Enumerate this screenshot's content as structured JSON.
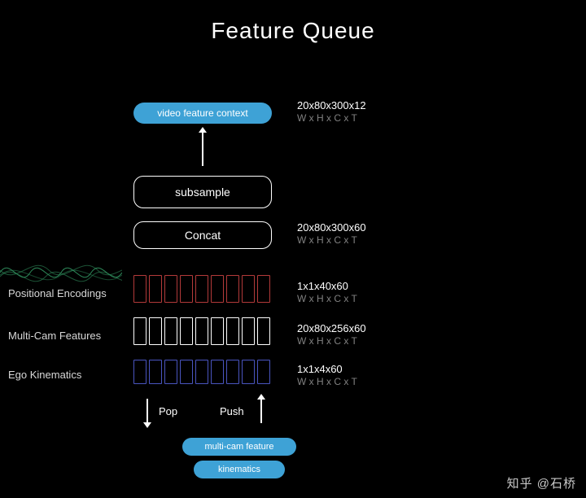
{
  "title": "Feature Queue",
  "blocks": {
    "video_ctx": {
      "label": "video feature context",
      "shape": "20x80x300x12",
      "dims": "W x H x C x T"
    },
    "subsample": {
      "label": "subsample"
    },
    "concat": {
      "label": "Concat",
      "shape": "20x80x300x60",
      "dims": "W x H x C x T"
    }
  },
  "rows": {
    "pos_enc": {
      "label": "Positional Encodings",
      "shape": "1x1x40x60",
      "dims": "W x H x C x T"
    },
    "multicam": {
      "label": "Multi-Cam Features",
      "shape": "20x80x256x60",
      "dims": "W x H x C x T"
    },
    "ego": {
      "label": "Ego Kinematics",
      "shape": "1x1x4x60",
      "dims": "W x H x C x T"
    }
  },
  "ops": {
    "pop": "Pop",
    "push": "Push"
  },
  "inputs": {
    "multicam": "multi-cam feature",
    "kinematics": "kinematics"
  },
  "watermark": "知乎 @石桥"
}
